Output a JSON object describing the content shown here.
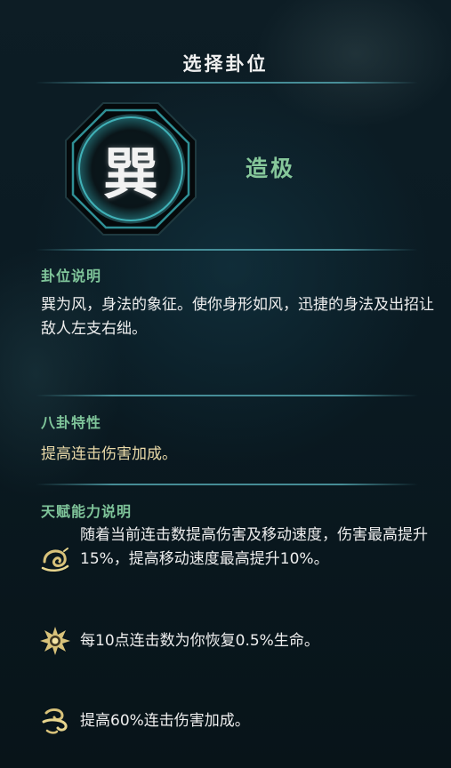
{
  "header": {
    "title": "选择卦位"
  },
  "trigram": {
    "symbol": "巽",
    "rank": "造极"
  },
  "description": {
    "label": "卦位说明",
    "text": "巽为风，身法的象征。使你身形如风，迅捷的身法及出招让敌人左支右绌。"
  },
  "trait": {
    "label": "八卦特性",
    "text": "提高连击伤害加成。"
  },
  "talents": {
    "label": "天赋能力说明",
    "items": [
      {
        "icon": "wind-swirl-icon",
        "text": "随着当前连击数提高伤害及移动速度，伤害最高提升15%，提高移动速度最高提升10%。"
      },
      {
        "icon": "sunburst-icon",
        "text": "每10点连击数为你恢复0.5%生命。"
      },
      {
        "icon": "gale-icon",
        "text": "提高60%连击伤害加成。"
      }
    ]
  },
  "colors": {
    "accent": "#7fc59a",
    "trait_text": "#e9d9a8",
    "icon_gold": "#d8c27a",
    "frame": "#2f8f95"
  }
}
